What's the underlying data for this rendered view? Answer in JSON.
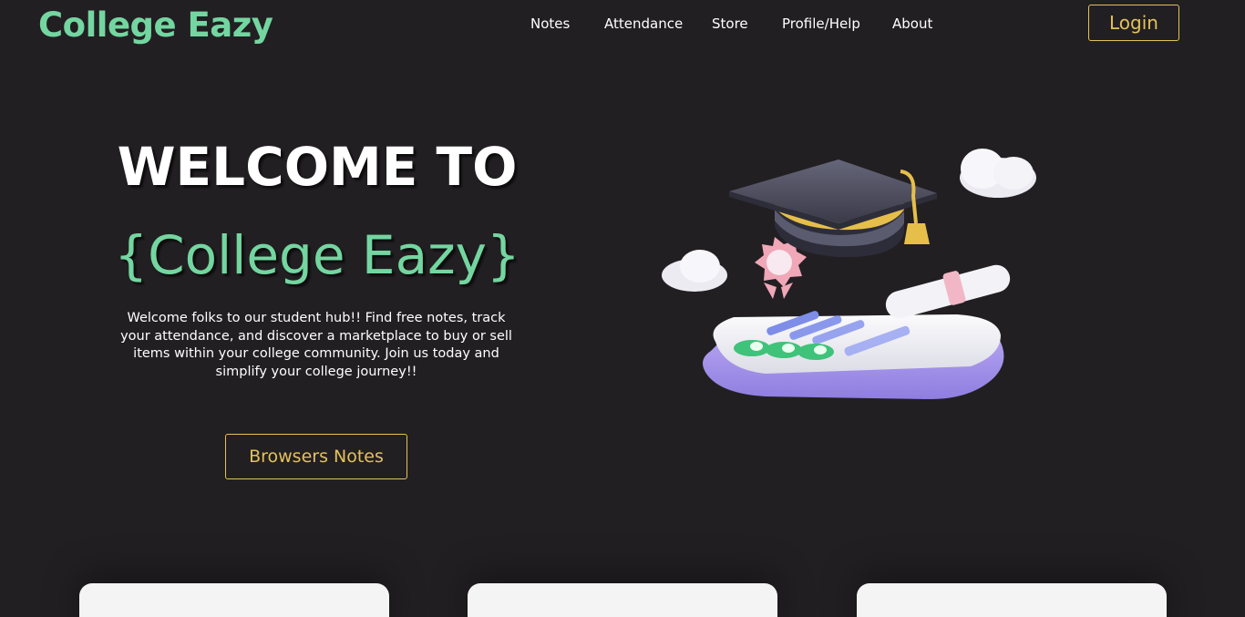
{
  "brand": "College Eazy",
  "nav": {
    "items": [
      "Notes",
      "Attendance",
      "Store",
      "Profile/Help",
      "About"
    ],
    "login_label": "Login"
  },
  "hero": {
    "title": "WELCOME TO",
    "brand_line": "{College Eazy}",
    "description": "Welcome folks to our student hub!! Find free notes, track your attendance, and discover a marketplace to buy or sell items within your college community. Join us today and simplify your college journey!!",
    "cta_label": "Browsers Notes"
  },
  "colors": {
    "background": "#221f22",
    "brand_green": "#73d6a0",
    "accent_gold": "#e2c25a",
    "card": "#f4f4f4"
  },
  "illustration": {
    "icon": "graduation-illustration"
  }
}
